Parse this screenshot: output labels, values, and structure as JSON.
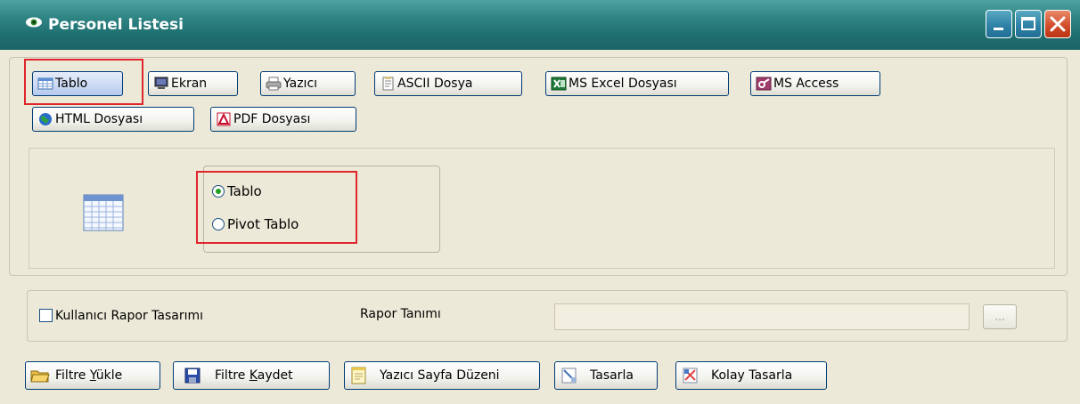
{
  "window": {
    "title": "Personel Listesi",
    "colors": {
      "titlebar": "#2f8484",
      "close": "#d04a28",
      "body": "#ece9d8",
      "highlight": "#e0262c"
    }
  },
  "output_buttons": [
    {
      "label": "Tablo",
      "icon": "table-icon",
      "active": true
    },
    {
      "label": "Ekran",
      "icon": "monitor-icon"
    },
    {
      "label": "Yazıcı",
      "icon": "printer-icon"
    },
    {
      "label": "ASCII Dosya",
      "icon": "text-file-icon"
    },
    {
      "label": "MS Excel Dosyası",
      "icon": "excel-icon"
    },
    {
      "label": "MS Access",
      "icon": "access-icon"
    },
    {
      "label": "HTML Dosyası",
      "icon": "globe-icon"
    },
    {
      "label": "PDF Dosyası",
      "icon": "pdf-icon"
    }
  ],
  "table_options": {
    "selected": "Tablo",
    "options": [
      "Tablo",
      "Pivot Tablo"
    ]
  },
  "report": {
    "custom_design_label": "Kullanıcı Rapor Tasarımı",
    "custom_design_checked": false,
    "definition_label": "Rapor Tanımı",
    "definition_value": "",
    "browse_label": "..."
  },
  "bottom_buttons": [
    {
      "label_pre": "Filtre ",
      "label_underline": "Y",
      "label_post": "ükle",
      "icon": "folder-open-icon"
    },
    {
      "label_pre": "Filtre ",
      "label_underline": "K",
      "label_post": "aydet",
      "icon": "save-icon"
    },
    {
      "label_pre": "Yazıcı Sayfa Düzeni",
      "label_underline": "",
      "label_post": "",
      "icon": "page-setup-icon"
    },
    {
      "label_pre": "Tasarla",
      "label_underline": "",
      "label_post": "",
      "icon": "design-icon"
    },
    {
      "label_pre": "Kolay Tasarla",
      "label_underline": "",
      "label_post": "",
      "icon": "easy-design-icon"
    }
  ]
}
